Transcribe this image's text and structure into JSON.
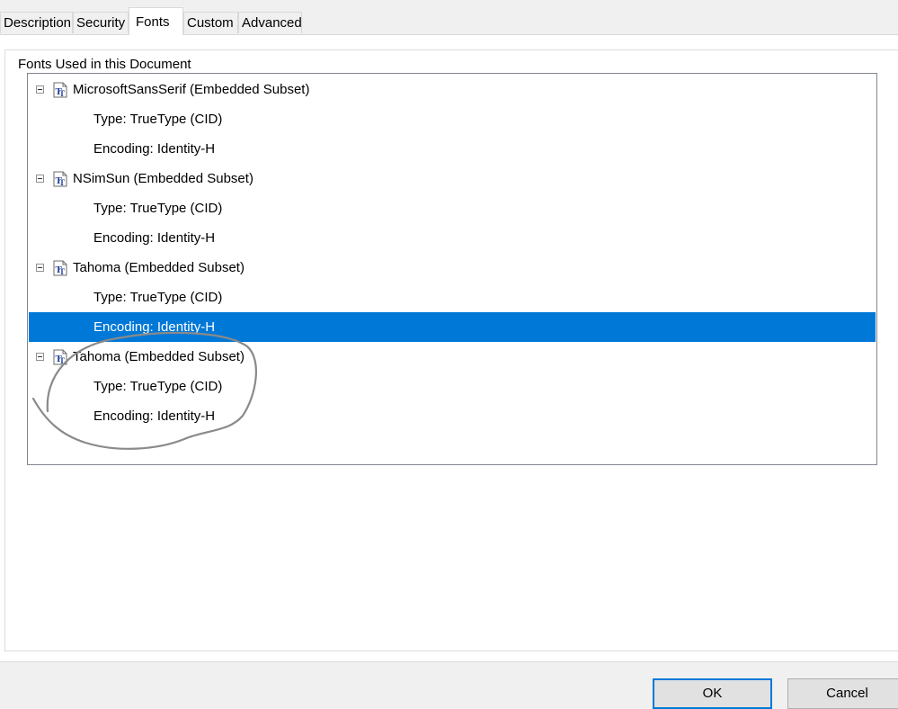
{
  "tabs": [
    {
      "label": "Description",
      "active": false
    },
    {
      "label": "Security",
      "active": false
    },
    {
      "label": "Fonts",
      "active": true
    },
    {
      "label": "Custom",
      "active": false
    },
    {
      "label": "Advanced",
      "active": false
    }
  ],
  "fonts_group": {
    "title": "Fonts Used in this Document",
    "fonts": [
      {
        "name": "MicrosoftSansSerif (Embedded Subset)",
        "type": "Type: TrueType (CID)",
        "encoding": "Encoding: Identity-H"
      },
      {
        "name": "NSimSun (Embedded Subset)",
        "type": "Type: TrueType (CID)",
        "encoding": "Encoding: Identity-H"
      },
      {
        "name": "Tahoma (Embedded Subset)",
        "type": "Type: TrueType (CID)",
        "encoding": "Encoding: Identity-H"
      },
      {
        "name": "Tahoma (Embedded Subset)",
        "type": "Type: TrueType (CID)",
        "encoding": "Encoding: Identity-H"
      }
    ],
    "selected_row": "fonts.2.encoding",
    "icon": "truetype-font-icon",
    "selection_color": "#0078d7"
  },
  "buttons": {
    "ok_label": "OK",
    "cancel_label": "Cancel"
  }
}
